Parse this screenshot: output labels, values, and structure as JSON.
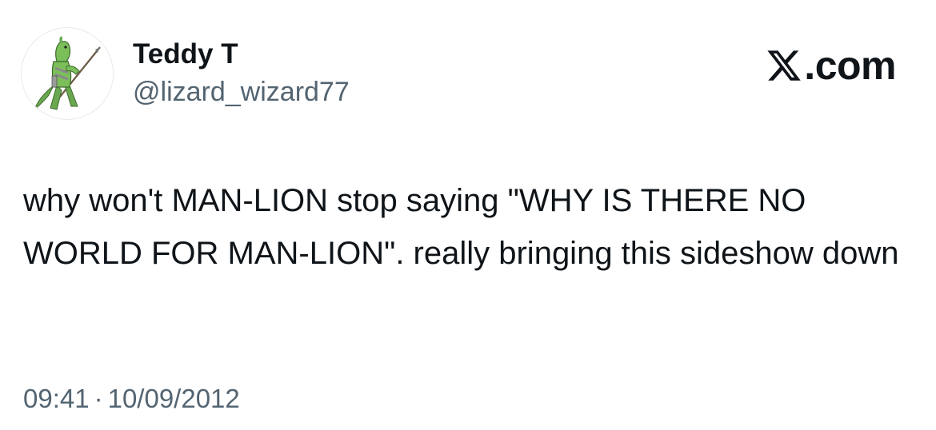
{
  "author": {
    "display_name": "Teddy T",
    "handle": "@lizard_wizard77",
    "avatar_icon": "lizard-warrior-avatar"
  },
  "brand": {
    "icon": "x-logo-icon",
    "text": ".com"
  },
  "tweet": {
    "text": "why won't MAN-LION stop saying \"WHY IS THERE NO WORLD FOR MAN-LION\". really bringing this sideshow down",
    "time": "09:41",
    "separator": "·",
    "date": "10/09/2012"
  },
  "colors": {
    "text_primary": "#0f1419",
    "text_secondary": "#536471",
    "background": "#ffffff"
  }
}
